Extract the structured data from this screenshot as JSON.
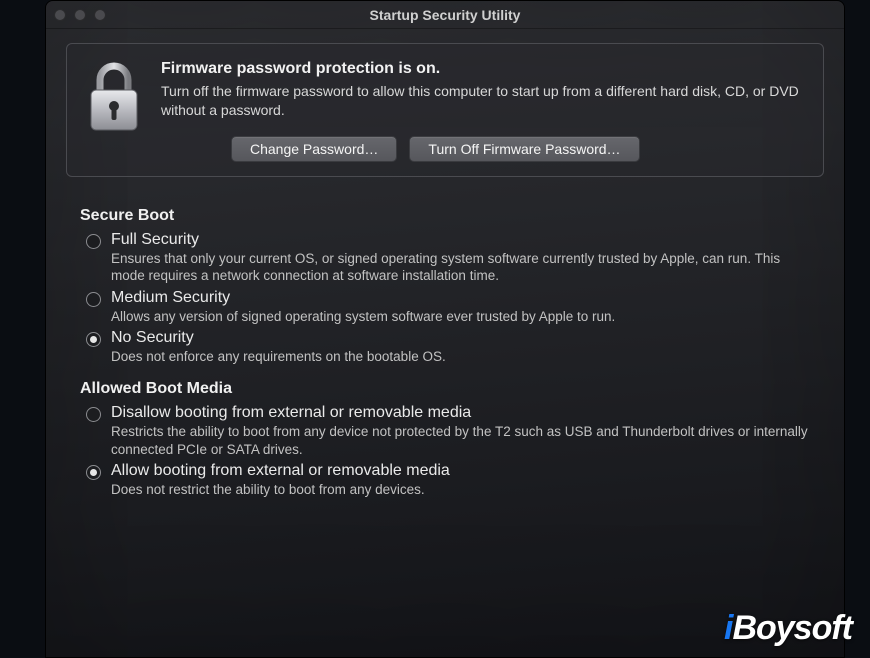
{
  "window": {
    "title": "Startup Security Utility"
  },
  "header": {
    "heading": "Firmware password protection is on.",
    "description": "Turn off the firmware password to allow this computer to start up from a different hard disk, CD, or DVD without a password.",
    "change_password_label": "Change Password…",
    "turn_off_label": "Turn Off Firmware Password…"
  },
  "secure_boot": {
    "title": "Secure Boot",
    "options": [
      {
        "label": "Full Security",
        "desc": "Ensures that only your current OS, or signed operating system software currently trusted by Apple, can run. This mode requires a network connection at software installation time.",
        "selected": false
      },
      {
        "label": "Medium Security",
        "desc": "Allows any version of signed operating system software ever trusted by Apple to run.",
        "selected": false
      },
      {
        "label": "No Security",
        "desc": "Does not enforce any requirements on the bootable OS.",
        "selected": true
      }
    ]
  },
  "allowed_boot": {
    "title": "Allowed Boot Media",
    "options": [
      {
        "label": "Disallow booting from external or removable media",
        "desc": "Restricts the ability to boot from any device not protected by the T2 such as USB and Thunderbolt drives or internally connected PCIe or SATA drives.",
        "selected": false
      },
      {
        "label": "Allow booting from external or removable media",
        "desc": "Does not restrict the ability to boot from any devices.",
        "selected": true
      }
    ]
  },
  "watermark": {
    "brand_prefix": "i",
    "brand_rest": "Boysoft"
  }
}
